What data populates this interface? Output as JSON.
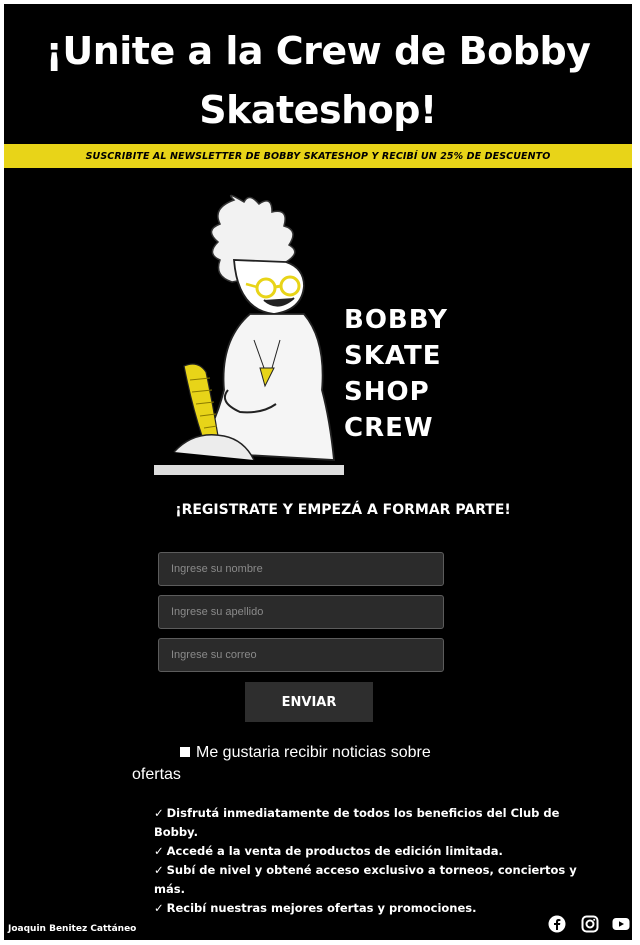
{
  "header": {
    "title_line1": "¡Unite a la Crew de Bobby",
    "title_line2": "Skateshop!",
    "banner": "SUSCRIBITE AL NEWSLETTER DE BOBBY SKATESHOP Y RECIBÍ UN 25% DE DESCUENTO",
    "banner_color": "#e8d418"
  },
  "logo": {
    "lines": [
      "BOBBY",
      "SKATE",
      "SHOP",
      "CREW"
    ]
  },
  "form": {
    "subtitle": "¡REGISTRATE Y EMPEZÁ A FORMAR PARTE!",
    "name_placeholder": "Ingrese su nombre",
    "surname_placeholder": "Ingrese su apellido",
    "email_placeholder": "Ingrese su correo",
    "submit_label": "ENVIAR",
    "checkbox_label_1": "Me gustaria recibir noticias sobre",
    "checkbox_label_2": "ofertas"
  },
  "benefits": [
    "Disfrutá inmediatamente de todos los beneficios del Club de Bobby.",
    "Accedé a la venta de productos de edición limitada.",
    "Subí de nivel y obtené acceso exclusivo a torneos, conciertos y más.",
    "Recibí nuestras mejores ofertas y promociones."
  ],
  "footer": {
    "author": "Joaquin Benitez Cattáneo",
    "social_icons": [
      "facebook-icon",
      "instagram-icon",
      "youtube-icon"
    ]
  }
}
